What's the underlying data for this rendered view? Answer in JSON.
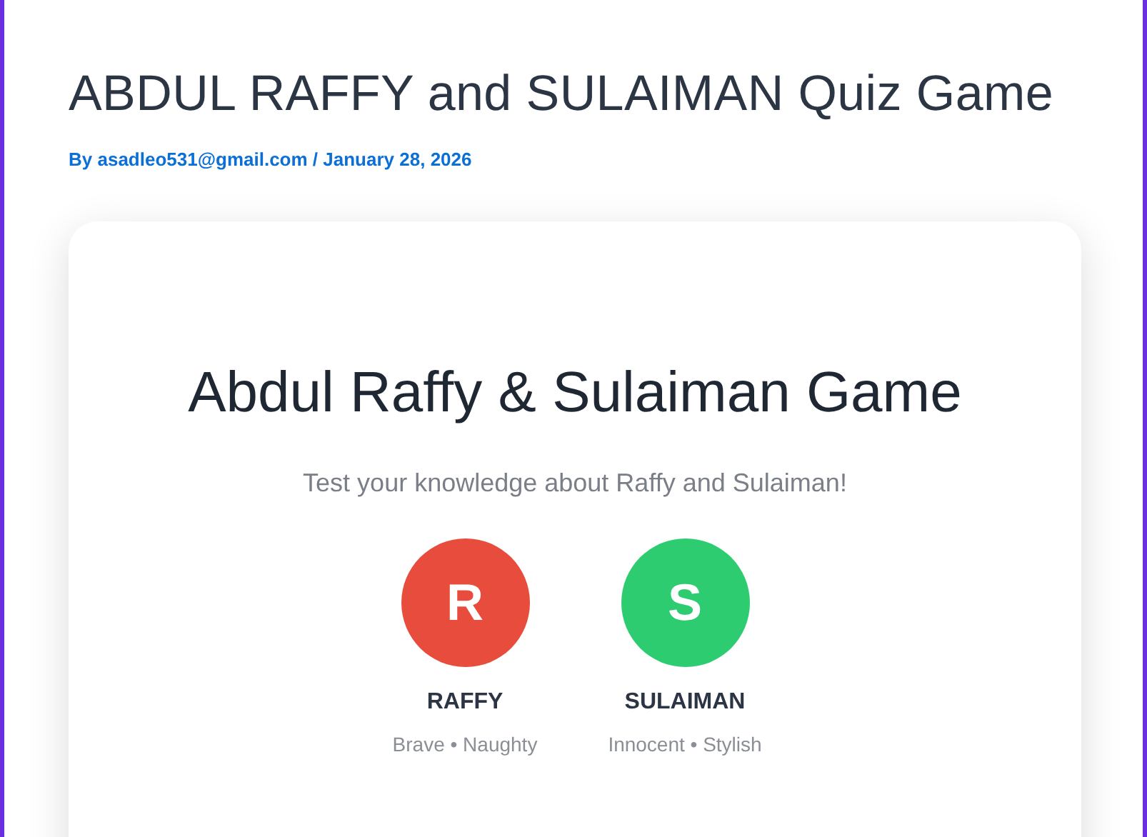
{
  "post": {
    "title": "ABDUL RAFFY and SULAIMAN Quiz Game",
    "byline": {
      "prefix": "By",
      "author": "asadleo531@gmail.com",
      "separator": "/",
      "date": "January 28, 2026"
    }
  },
  "game": {
    "title": "Abdul Raffy & Sulaiman Game",
    "subtitle": "Test your knowledge about Raffy and Sulaiman!",
    "players": [
      {
        "initial": "R",
        "name": "RAFFY",
        "traits": "Brave • Naughty",
        "color": "#e74c3c"
      },
      {
        "initial": "S",
        "name": "SULAIMAN",
        "traits": "Innocent • Stylish",
        "color": "#2ecc71"
      }
    ]
  }
}
